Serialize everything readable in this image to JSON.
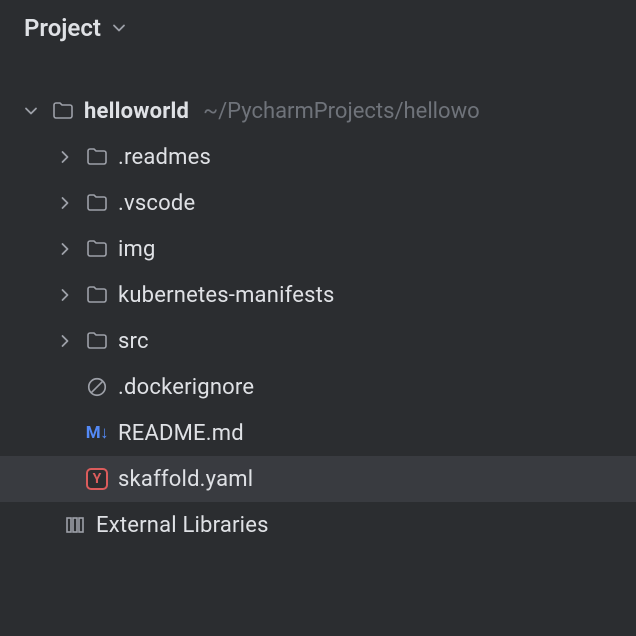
{
  "header": {
    "title": "Project"
  },
  "tree": {
    "root": {
      "name": "helloworld",
      "path": "~/PycharmProjects/hellowo"
    },
    "children": [
      {
        "name": ".readmes",
        "type": "folder",
        "expandable": true
      },
      {
        "name": ".vscode",
        "type": "folder",
        "expandable": true
      },
      {
        "name": "img",
        "type": "folder",
        "expandable": true
      },
      {
        "name": "kubernetes-manifests",
        "type": "folder",
        "expandable": true
      },
      {
        "name": "src",
        "type": "folder",
        "expandable": true
      },
      {
        "name": ".dockerignore",
        "type": "ignore",
        "expandable": false
      },
      {
        "name": "README.md",
        "type": "markdown",
        "expandable": false
      },
      {
        "name": "skaffold.yaml",
        "type": "yaml",
        "expandable": false,
        "selected": true
      }
    ],
    "external": {
      "name": "External Libraries"
    }
  },
  "icons": {
    "md_text": "M↓",
    "yaml_text": "Y"
  }
}
